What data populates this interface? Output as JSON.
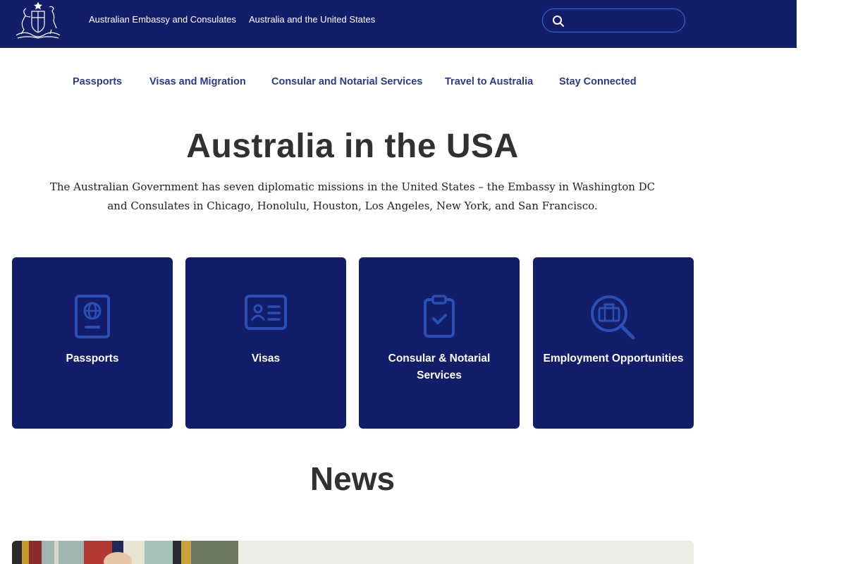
{
  "header": {
    "top_links": [
      "Australian Embassy and Consulates",
      "Australia and the United States"
    ],
    "search_placeholder": ""
  },
  "nav": {
    "items": [
      "Passports",
      "Visas and Migration",
      "Consular and Notarial Services",
      "Travel to Australia",
      "Stay Connected"
    ]
  },
  "main": {
    "title": "Australia in the USA",
    "intro": "The Australian Government has seven diplomatic missions in the United States – the Embassy in Washington DC and Consulates in Chicago, Honolulu, Houston, Los Angeles, New York, and San Francisco."
  },
  "cards": [
    {
      "label": "Passports",
      "icon": "passport-icon"
    },
    {
      "label": "Visas",
      "icon": "id-card-icon"
    },
    {
      "label": "Consular & Notarial Services",
      "icon": "clipboard-check-icon"
    },
    {
      "label": "Employment Opportunities",
      "icon": "briefcase-search-icon"
    }
  ],
  "news": {
    "title": "News"
  },
  "colors": {
    "brand_navy": "#131e6b",
    "nav_text": "#2b3b8c",
    "icon_blue": "#2a4fb5",
    "news_card_bg": "#efede8"
  }
}
